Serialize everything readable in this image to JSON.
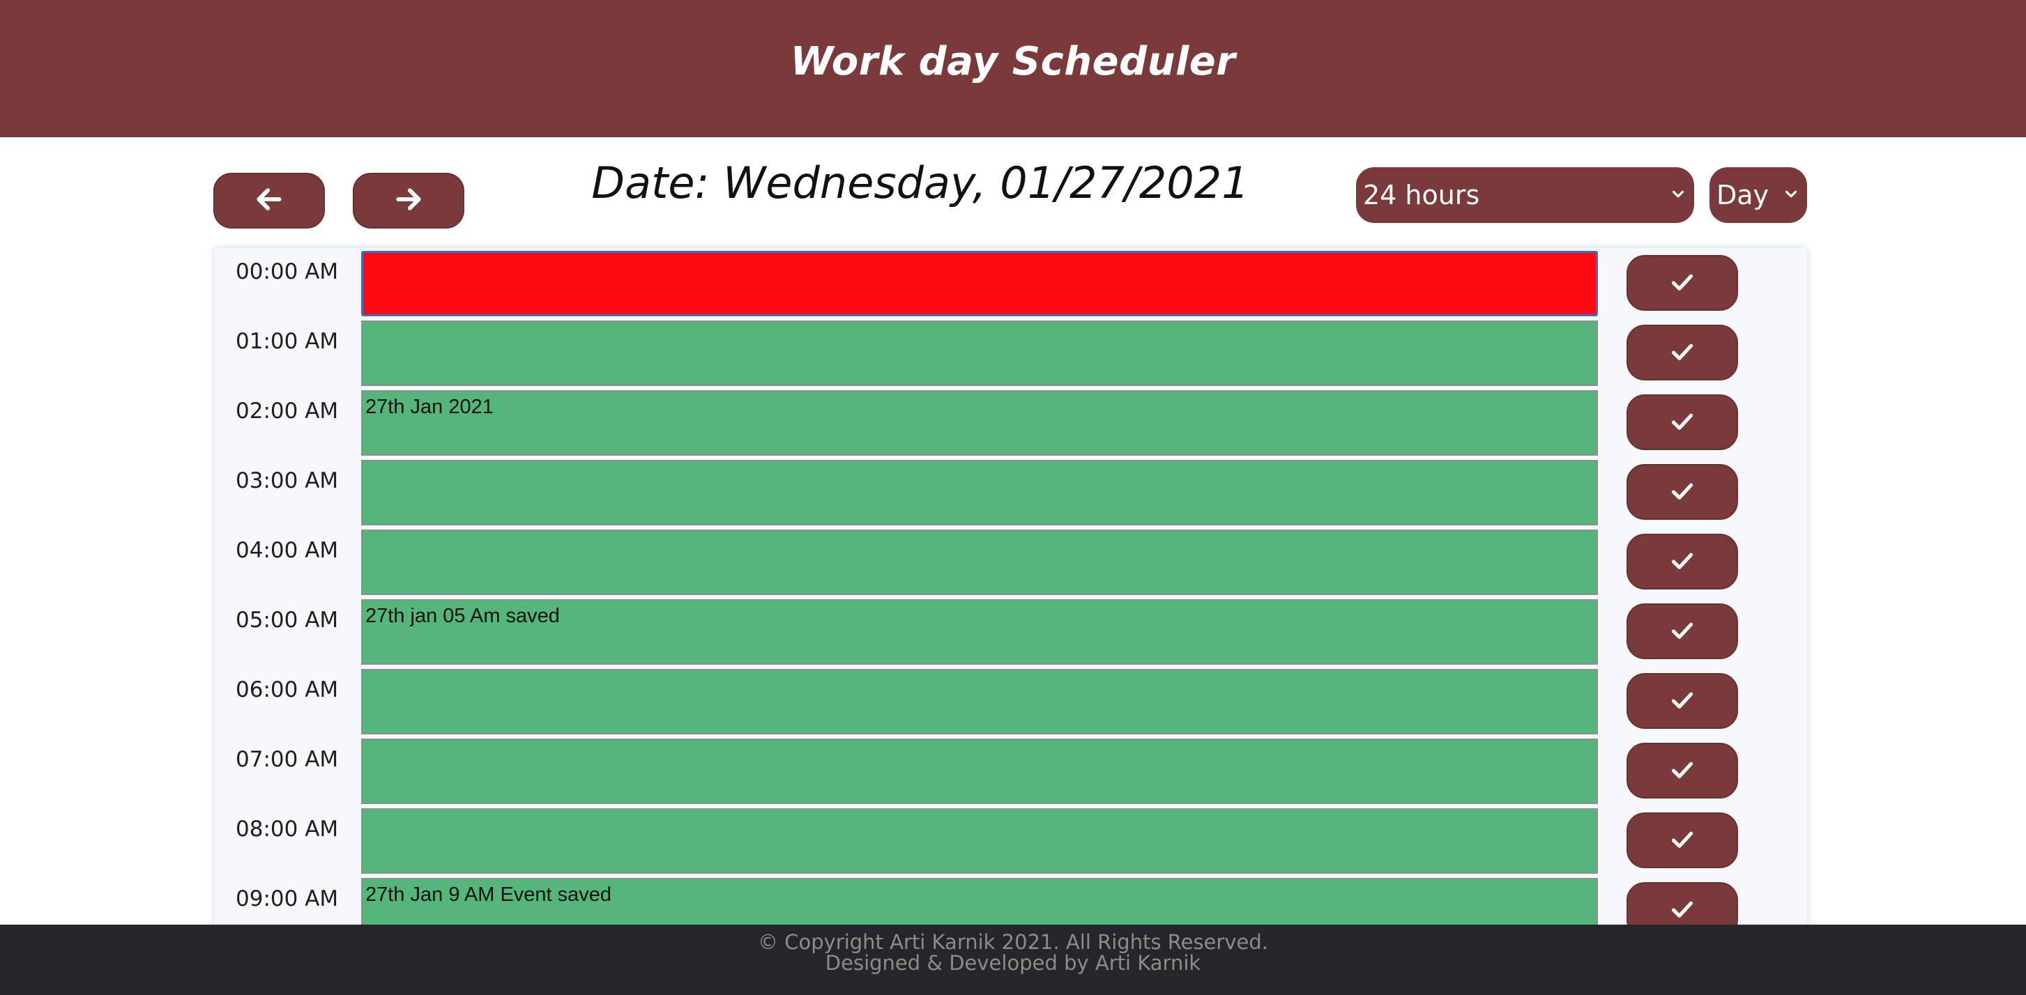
{
  "header": {
    "title": "Work day Scheduler"
  },
  "controls": {
    "prev_icon": "arrow-left-icon",
    "next_icon": "arrow-right-icon",
    "date_text": "Date: Wednesday, 01/27/2021",
    "hours_select": {
      "selected": "24 hours"
    },
    "view_select": {
      "selected": "Day"
    }
  },
  "schedule": {
    "rows": [
      {
        "time": "00:00 AM",
        "text": "",
        "state": "past"
      },
      {
        "time": "01:00 AM",
        "text": "",
        "state": "future"
      },
      {
        "time": "02:00 AM",
        "text": "27th Jan 2021",
        "state": "future"
      },
      {
        "time": "03:00 AM",
        "text": "",
        "state": "future"
      },
      {
        "time": "04:00 AM",
        "text": "",
        "state": "future"
      },
      {
        "time": "05:00 AM",
        "text": "27th jan 05 Am saved",
        "state": "future"
      },
      {
        "time": "06:00 AM",
        "text": "",
        "state": "future"
      },
      {
        "time": "07:00 AM",
        "text": "",
        "state": "future"
      },
      {
        "time": "08:00 AM",
        "text": "",
        "state": "future"
      },
      {
        "time": "09:00 AM",
        "text": "27th Jan 9 AM Event saved",
        "state": "future"
      }
    ],
    "save_icon": "checkmark-icon"
  },
  "footer": {
    "copyright": "© Copyright Arti Karnik 2021. All Rights Reserved.",
    "credit": "Designed & Developed by Arti Karnik"
  },
  "colors": {
    "brand": "#7a393b",
    "past": "#ff0a10",
    "future": "#54b67b",
    "footer_bg": "#252628"
  }
}
